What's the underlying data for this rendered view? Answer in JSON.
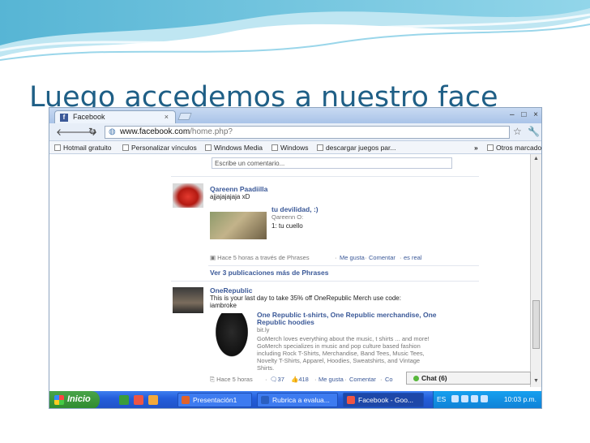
{
  "slide": {
    "title": "Luego accedemos a nuestro face"
  },
  "browser": {
    "tab_title": "Facebook",
    "tab_close": "×",
    "url_main": "www.facebook.com",
    "url_rest": "/home.php?",
    "window_controls": [
      "–",
      "□",
      "×"
    ]
  },
  "bookmarks": [
    "Hotmail gratuito",
    "Personalizar vínculos",
    "Windows Media",
    "Windows",
    "descargar juegos par...",
    "»",
    "Otros marcadores"
  ],
  "feed": {
    "comment_placeholder": "Escribe un comentario...",
    "post1": {
      "author": "Qareenn Paadiilla",
      "text": "ajjajajajaja xD",
      "attachment_title": "tu devilidad, :)",
      "attachment_author": "Qareenn O:",
      "attachment_text": "1: tu cuello",
      "meta": "Hace 5 horas a través de Phrases",
      "actions": [
        "Me gusta",
        "Comentar",
        "es real"
      ]
    },
    "more_link": "Ver 3 publicaciones más de Phrases",
    "post2": {
      "author": "OneRepublic",
      "text_line1": "This is your last day to take 35% off OneRepublic Merch use code:",
      "text_line2": "iambroke",
      "attachment_title_line1": "One Republic t-shirts, One Republic merchandise, One",
      "attachment_title_line2": "Republic hoodies",
      "attachment_source": "bit.ly",
      "desc": [
        "GoMerch loves everything about the music, t shirts ... and more!",
        "GoMerch specializes in music and pop culture based fashion",
        "including Rock T-Shirts, Merchandise, Band Tees, Music Tees,",
        "Novelty T-Shirts, Apparel, Hoodies, Sweatshirts, and Vintage",
        "Shirts."
      ],
      "meta_time": "Hace 5 horas",
      "comments_count": "37",
      "likes_count": "418",
      "actions": [
        "Me gusta",
        "Comentar",
        "Co"
      ]
    },
    "chat_label": "Chat (6)"
  },
  "taskbar": {
    "start_label": "Inicio",
    "tasks": [
      "Presentación1",
      "Rubrica a evalua...",
      "Facebook - Goo...",
      "ES"
    ],
    "clock": "10:03 p.m."
  }
}
